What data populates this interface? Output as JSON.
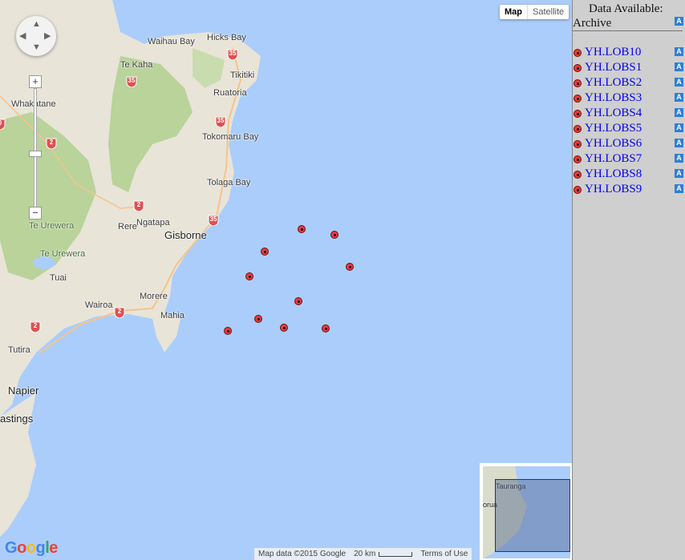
{
  "map": {
    "type_buttons": [
      "Map",
      "Satellite"
    ],
    "active_type": "Map",
    "pan_arrows": [
      "▲",
      "▼",
      "◀",
      "▶"
    ],
    "zoom_in": "+",
    "zoom_out": "−",
    "logo": "Google",
    "logo_colors": [
      "#4285f4",
      "#ea4335",
      "#fbbc05",
      "#4285f4",
      "#34a853",
      "#ea4335"
    ],
    "attribution": "Map data ©2015 Google",
    "scale_label": "20 km",
    "terms": "Terms of Use",
    "places": [
      "Hicks Bay",
      "Waihau Bay",
      "Te Kaha",
      "Tikitiki",
      "Whakatane",
      "Ruatoria",
      "Tokomaru Bay",
      "Tolaga Bay",
      "Ngatapa",
      "Rere",
      "Gisborne",
      "Te Urewera",
      "Te Urewera",
      "Tuai",
      "Morere",
      "Wairoa",
      "Mahia",
      "Tutira",
      "Napier",
      "astings"
    ],
    "highway_shields": [
      "35",
      "35",
      "35",
      "35",
      "35",
      "2",
      "2",
      "2",
      "2",
      "0"
    ],
    "overview_labels": [
      "Tauranga",
      "orua"
    ],
    "land_color": "#e8e4d8",
    "forest_color": "#b9d39a",
    "water_color": "#abcdfb",
    "station_marker_color": "#e83b3b"
  },
  "sidebar": {
    "title": "Data Available:",
    "subtitle": "Archive",
    "icon_letter": "A",
    "stations": [
      "YH.LOB10",
      "YH.LOBS1",
      "YH.LOBS2",
      "YH.LOBS3",
      "YH.LOBS4",
      "YH.LOBS5",
      "YH.LOBS6",
      "YH.LOBS7",
      "YH.LOBS8",
      "YH.LOBS9"
    ]
  }
}
